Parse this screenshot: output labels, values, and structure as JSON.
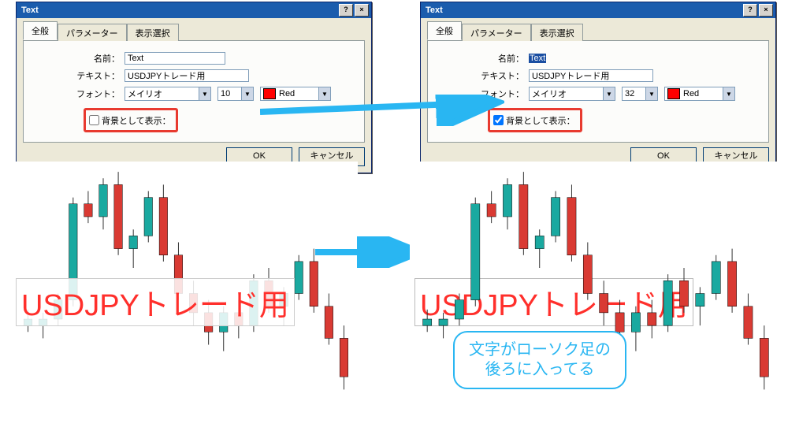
{
  "dialog": {
    "title": "Text",
    "tabs": {
      "general": "全般",
      "parameters": "パラメーター",
      "display": "表示選択"
    },
    "labels": {
      "name": "名前：",
      "text": "テキスト：",
      "font": "フォント：",
      "background": "背景として表示："
    },
    "fields": {
      "name": "Text",
      "text": "USDJPYトレード用",
      "font": "メイリオ",
      "color_name": "Red"
    },
    "buttons": {
      "ok": "OK",
      "cancel": "キャンセル"
    }
  },
  "left": {
    "size": "10",
    "bg_checked": false
  },
  "right": {
    "size": "32",
    "bg_checked": true
  },
  "chart_text": "USDJPYトレード用",
  "callout_line1": "文字がローソク足の",
  "callout_line2": "後ろに入ってる",
  "chart_data": {
    "type": "candlestick",
    "note": "decorative example; no axes/values shown",
    "series": [
      {
        "o": 52,
        "h": 55,
        "l": 48,
        "c": 50,
        "color": "teal"
      },
      {
        "o": 50,
        "h": 54,
        "l": 46,
        "c": 52,
        "color": "teal"
      },
      {
        "o": 52,
        "h": 60,
        "l": 50,
        "c": 58,
        "color": "teal"
      },
      {
        "o": 58,
        "h": 90,
        "l": 56,
        "c": 88,
        "color": "teal"
      },
      {
        "o": 88,
        "h": 92,
        "l": 82,
        "c": 84,
        "color": "red"
      },
      {
        "o": 84,
        "h": 96,
        "l": 80,
        "c": 94,
        "color": "teal"
      },
      {
        "o": 94,
        "h": 98,
        "l": 72,
        "c": 74,
        "color": "red"
      },
      {
        "o": 74,
        "h": 80,
        "l": 68,
        "c": 78,
        "color": "teal"
      },
      {
        "o": 78,
        "h": 92,
        "l": 76,
        "c": 90,
        "color": "teal"
      },
      {
        "o": 90,
        "h": 94,
        "l": 70,
        "c": 72,
        "color": "red"
      },
      {
        "o": 72,
        "h": 76,
        "l": 58,
        "c": 60,
        "color": "red"
      },
      {
        "o": 60,
        "h": 64,
        "l": 50,
        "c": 54,
        "color": "red"
      },
      {
        "o": 54,
        "h": 58,
        "l": 44,
        "c": 48,
        "color": "red"
      },
      {
        "o": 48,
        "h": 56,
        "l": 42,
        "c": 54,
        "color": "teal"
      },
      {
        "o": 54,
        "h": 58,
        "l": 46,
        "c": 50,
        "color": "red"
      },
      {
        "o": 50,
        "h": 66,
        "l": 48,
        "c": 64,
        "color": "teal"
      },
      {
        "o": 64,
        "h": 68,
        "l": 54,
        "c": 56,
        "color": "red"
      },
      {
        "o": 56,
        "h": 62,
        "l": 50,
        "c": 60,
        "color": "teal"
      },
      {
        "o": 60,
        "h": 72,
        "l": 58,
        "c": 70,
        "color": "teal"
      },
      {
        "o": 70,
        "h": 74,
        "l": 54,
        "c": 56,
        "color": "red"
      },
      {
        "o": 56,
        "h": 60,
        "l": 44,
        "c": 46,
        "color": "red"
      },
      {
        "o": 46,
        "h": 50,
        "l": 30,
        "c": 34,
        "color": "red"
      }
    ]
  }
}
